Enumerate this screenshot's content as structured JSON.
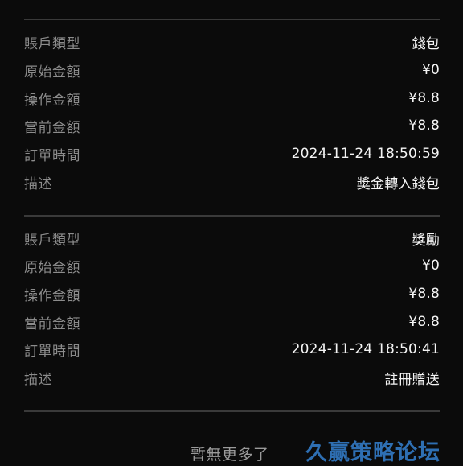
{
  "records": [
    {
      "account_type": {
        "label": "賬戶類型",
        "value": "錢包"
      },
      "original_amount": {
        "label": "原始金額",
        "value": "¥0"
      },
      "operation_amount": {
        "label": "操作金額",
        "value": "¥8.8"
      },
      "current_amount": {
        "label": "當前金額",
        "value": "¥8.8"
      },
      "order_time": {
        "label": "訂單時間",
        "value": "2024-11-24 18:50:59"
      },
      "description": {
        "label": "描述",
        "value": "獎金轉入錢包"
      }
    },
    {
      "account_type": {
        "label": "賬戶類型",
        "value": "獎勵"
      },
      "original_amount": {
        "label": "原始金額",
        "value": "¥0"
      },
      "operation_amount": {
        "label": "操作金額",
        "value": "¥8.8"
      },
      "current_amount": {
        "label": "當前金額",
        "value": "¥8.8"
      },
      "order_time": {
        "label": "訂單時間",
        "value": "2024-11-24 18:50:41"
      },
      "description": {
        "label": "描述",
        "value": "註冊贈送"
      }
    }
  ],
  "footer": {
    "no_more_text": "暫無更多了"
  },
  "watermark": {
    "text": "久赢策略论坛"
  }
}
